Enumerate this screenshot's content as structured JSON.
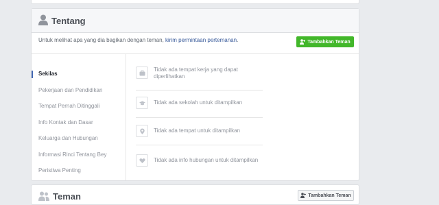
{
  "about": {
    "title": "Tentang",
    "intro_text": "Untuk melihat apa yang dia bagikan dengan teman, ",
    "intro_link": "kirim permintaan pertemanan",
    "intro_end": ".",
    "add_friend_label": "Tambahkan Teman",
    "nav": [
      {
        "label": "Sekilas",
        "active": true
      },
      {
        "label": "Pekerjaan dan Pendidikan"
      },
      {
        "label": "Tempat Pernah Ditinggali"
      },
      {
        "label": "Info Kontak dan Dasar"
      },
      {
        "label": "Keluarga dan Hubungan"
      },
      {
        "label": "Informasi Rinci Tentang Bey"
      },
      {
        "label": "Peristiwa Penting"
      }
    ],
    "overview": [
      {
        "icon": "briefcase-icon",
        "line1": "Tidak ada tempat kerja yang dapat",
        "line2": "diperlihatkan"
      },
      {
        "icon": "graduation-cap-icon",
        "line1": "Tidak ada sekolah untuk ditampilkan"
      },
      {
        "icon": "location-pin-icon",
        "line1": "Tidak ada tempat untuk ditampilkan"
      },
      {
        "icon": "heart-icon",
        "line1": "Tidak ada info hubungan untuk ditampilkan"
      }
    ]
  },
  "friends": {
    "title": "Teman",
    "add_friend_label": "Tambahkan Teman"
  },
  "colors": {
    "accent_green": "#42b72a",
    "link_blue": "#365899",
    "nav_indicator": "#4267b2"
  }
}
